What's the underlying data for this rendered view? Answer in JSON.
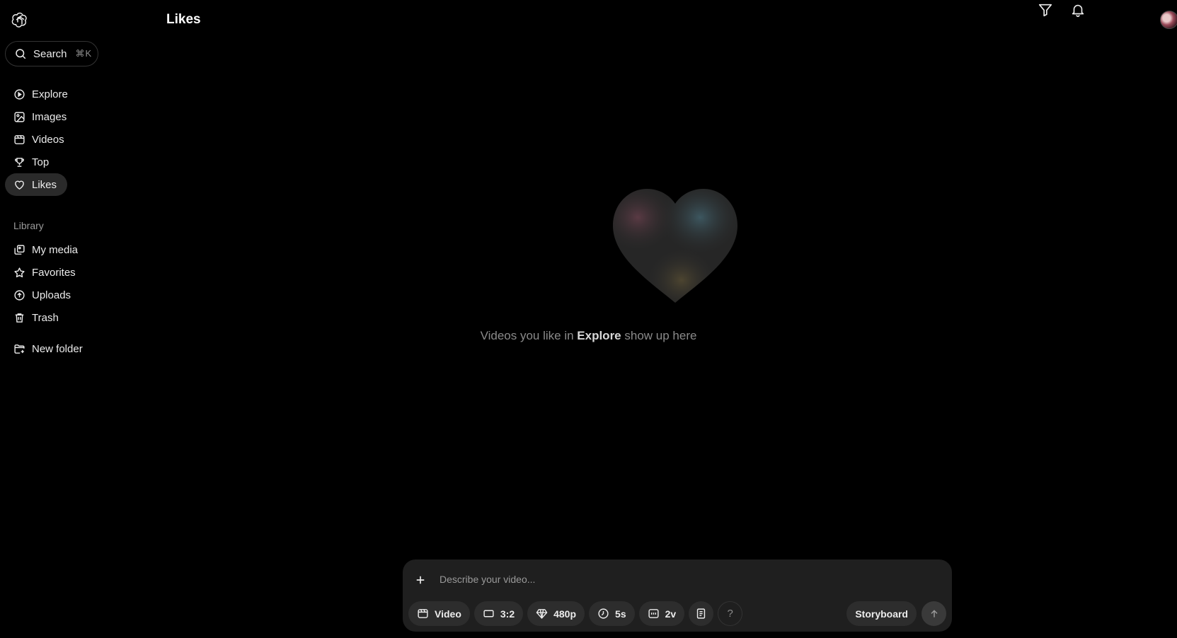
{
  "header": {
    "title": "Likes",
    "logo_icon": "openai-logo-icon",
    "filter_icon": "filter-icon",
    "notifications_icon": "bell-icon"
  },
  "search": {
    "label": "Search",
    "shortcut": "⌘K",
    "icon": "search-icon"
  },
  "sidebar": {
    "items": [
      {
        "label": "Explore",
        "icon": "compass-icon"
      },
      {
        "label": "Images",
        "icon": "image-icon"
      },
      {
        "label": "Videos",
        "icon": "video-icon"
      },
      {
        "label": "Top",
        "icon": "trophy-icon"
      },
      {
        "label": "Likes",
        "icon": "heart-icon",
        "active": true
      }
    ],
    "library_label": "Library",
    "library_items": [
      {
        "label": "My media",
        "icon": "media-icon"
      },
      {
        "label": "Favorites",
        "icon": "star-icon"
      },
      {
        "label": "Uploads",
        "icon": "upload-icon"
      },
      {
        "label": "Trash",
        "icon": "trash-icon"
      }
    ],
    "new_folder": {
      "label": "New folder",
      "icon": "folder-plus-icon"
    }
  },
  "empty_state": {
    "text_before": "Videos you like in ",
    "text_link": "Explore",
    "text_after": " show up here"
  },
  "composer": {
    "placeholder": "Describe your video...",
    "chips": [
      {
        "label": "Video",
        "icon": "video-icon"
      },
      {
        "label": "3:2",
        "icon": "aspect-ratio-icon"
      },
      {
        "label": "480p",
        "icon": "diamond-icon"
      },
      {
        "label": "5s",
        "icon": "clock-icon"
      },
      {
        "label": "2v",
        "icon": "variations-icon"
      }
    ],
    "presets_icon": "presets-icon",
    "help_label": "?",
    "storyboard_label": "Storyboard",
    "send_icon": "arrow-up-icon"
  }
}
